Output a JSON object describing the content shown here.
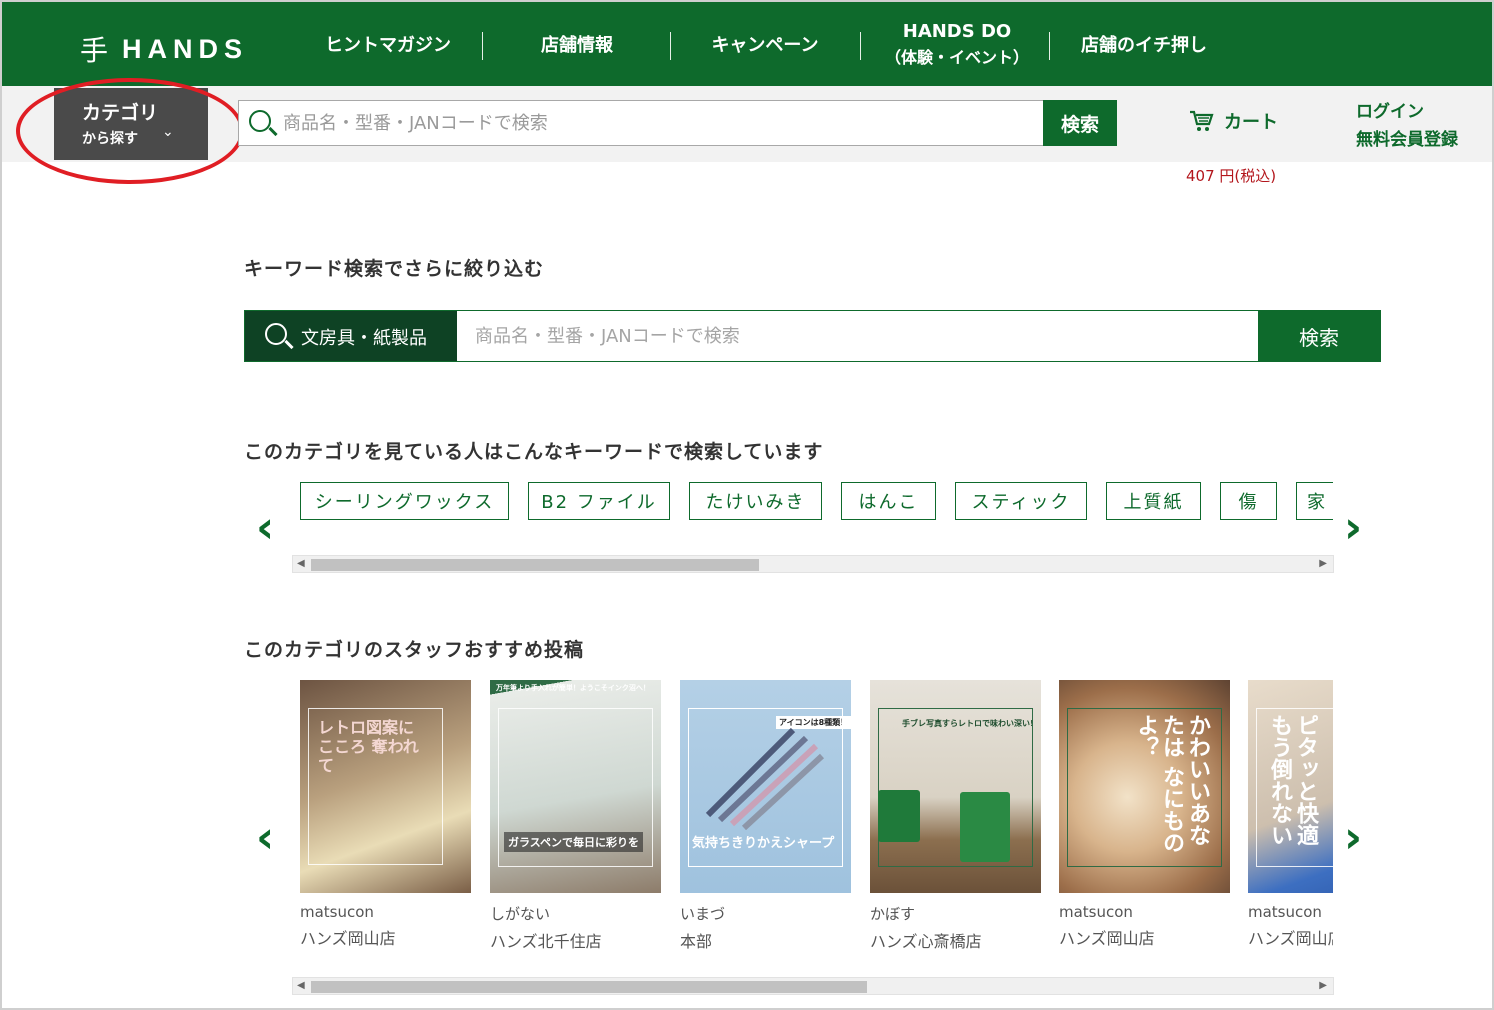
{
  "header": {
    "logo_mark": "手",
    "logo_text": "HANDS",
    "nav": [
      {
        "label": "ヒントマガジン",
        "sub": ""
      },
      {
        "label": "店舗情報",
        "sub": ""
      },
      {
        "label": "キャンペーン",
        "sub": ""
      },
      {
        "label": "HANDS DO",
        "sub": "（体験・イベント）"
      },
      {
        "label": "店舗のイチ押し",
        "sub": ""
      }
    ]
  },
  "subbar": {
    "category_button": {
      "line1": "カテゴリ",
      "line2": "から探す",
      "chevron": "⌄"
    },
    "search": {
      "placeholder": "商品名・型番・JANコードで検索",
      "value": "",
      "button": "検索"
    },
    "cart": {
      "label": "カート",
      "price": "407 円(税込)"
    },
    "login": "ログイン",
    "register": "無料会員登録"
  },
  "main": {
    "refine_heading": "キーワード検索でさらに絞り込む",
    "refine_search": {
      "category": "文房具・紙製品",
      "placeholder": "商品名・型番・JANコードで検索",
      "value": "",
      "button": "検索"
    },
    "keywords_heading": "このカテゴリを見ている人はこんなキーワードで検索しています",
    "keywords": [
      "シーリングワックス",
      "B2 ファイル",
      "たけいみき",
      "はんこ",
      "スティック",
      "上質紙",
      "傷",
      "家"
    ],
    "staff_heading": "このカテゴリのスタッフおすすめ投稿",
    "posts": [
      {
        "user": "matsucon",
        "store": "ハンズ岡山店",
        "caption": "レトロ図案に こころ 奪われて",
        "bg": "#8a6a52"
      },
      {
        "user": "しがない",
        "store": "ハンズ北千住店",
        "caption": "ガラスペンで毎日に彩りを",
        "top": "万年筆より手入れが簡単！ようこそインク沼へ！",
        "bg": "#6f8c78"
      },
      {
        "user": "いまづ",
        "store": "本部",
        "caption": "気持ちきりかえシャープ",
        "top": "アイコンは8種類！",
        "bg": "#a9c8de"
      },
      {
        "user": "かぼす",
        "store": "ハンズ心斎橋店",
        "caption": "",
        "top": "手ブレ写真すらレトロで味わい深い!",
        "bg": "#c9c3b4"
      },
      {
        "user": "matsucon",
        "store": "ハンズ岡山店",
        "caption": "かわいいあなたは なにものよ？",
        "bg": "#b98f6d"
      },
      {
        "user": "matsucon",
        "store": "ハンズ岡山店",
        "caption": "ピタッと快適 もう倒れない",
        "bg": "#d8cdbd"
      }
    ]
  },
  "colors": {
    "brand_green": "#0e6a2c",
    "dark_green": "#0e4224",
    "price_red": "#b3161c",
    "highlight_red": "#e01e24"
  },
  "icons": {
    "search": "magnifier-icon",
    "cart": "cart-icon",
    "prev": "chevron-left-icon",
    "next": "chevron-right-icon"
  }
}
